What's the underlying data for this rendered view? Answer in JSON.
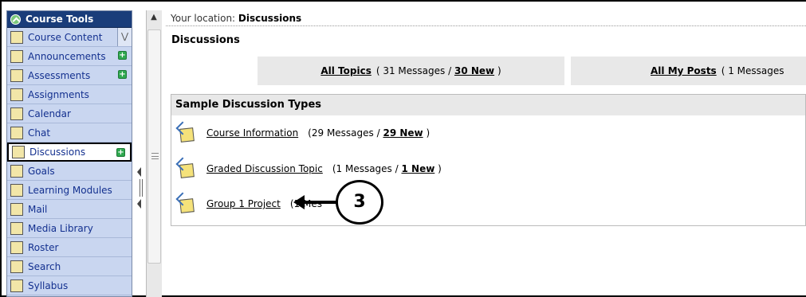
{
  "sidebar": {
    "header": "Course Tools",
    "items": [
      {
        "label": "Course Content",
        "icon": "home-icon",
        "extra": "chevron"
      },
      {
        "label": "Announcements",
        "icon": "megaphone-icon",
        "extra": "plus"
      },
      {
        "label": "Assessments",
        "icon": "clipboard-icon",
        "extra": "plus"
      },
      {
        "label": "Assignments",
        "icon": "pencil-icon"
      },
      {
        "label": "Calendar",
        "icon": "calendar-icon"
      },
      {
        "label": "Chat",
        "icon": "speech-bubble-icon"
      },
      {
        "label": "Discussions",
        "icon": "pin-icon",
        "extra": "plus",
        "active": true
      },
      {
        "label": "Goals",
        "icon": "target-icon"
      },
      {
        "label": "Learning Modules",
        "icon": "modules-icon"
      },
      {
        "label": "Mail",
        "icon": "envelope-icon"
      },
      {
        "label": "Media Library",
        "icon": "media-icon"
      },
      {
        "label": "Roster",
        "icon": "people-icon"
      },
      {
        "label": "Search",
        "icon": "magnifier-icon"
      },
      {
        "label": "Syllabus",
        "icon": "document-icon"
      }
    ]
  },
  "location": {
    "prefix": "Your location:",
    "current": "Discussions"
  },
  "page_title": "Discussions",
  "tabs": {
    "all_topics": {
      "label": "All Topics",
      "count_prefix": "( 31 Messages /",
      "new": "30 New",
      "suffix": ")"
    },
    "all_my_posts": {
      "label": "All My Posts",
      "count_prefix": "( 1 Messages"
    }
  },
  "panel": {
    "title": "Sample Discussion Types",
    "topics": [
      {
        "title": "Course Information",
        "count": "(29 Messages /",
        "new": "29 New",
        "suffix": ")"
      },
      {
        "title": "Graded Discussion Topic",
        "count": "(1 Messages /",
        "new": "1 New",
        "suffix": ")"
      },
      {
        "title": "Group 1 Project",
        "count": "(1 Mes",
        "new": "",
        "suffix": ""
      }
    ]
  },
  "callout": {
    "number": "3"
  },
  "colors": {
    "sidebar_bg": "#c9d6f0",
    "sidebar_header": "#1a3d7a",
    "link": "#13308f",
    "plus": "#2fa84f"
  }
}
